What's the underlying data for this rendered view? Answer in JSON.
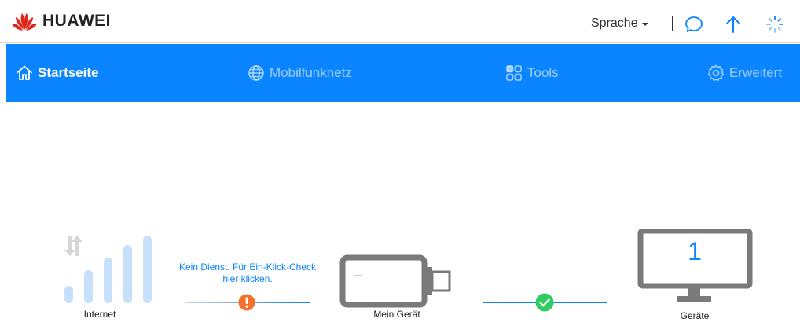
{
  "header": {
    "brand": "HUAWEI",
    "language_label": "Sprache",
    "icons": [
      "chat-icon",
      "update-arrow-icon",
      "loading-spinner-icon"
    ]
  },
  "nav": {
    "items": [
      {
        "label": "Startseite",
        "icon": "home-icon",
        "active": true
      },
      {
        "label": "Mobilfunknetz",
        "icon": "globe-icon",
        "active": false
      },
      {
        "label": "Tools",
        "icon": "grid-icon",
        "active": false
      },
      {
        "label": "Erweitert",
        "icon": "gear-icon",
        "active": false
      }
    ]
  },
  "status": {
    "internet_label": "Internet",
    "warning_text": "Kein Dienst. Für Ein-Klick-Check hier klicken.",
    "device_label": "Mein Gerät",
    "device_screen": "–",
    "devices_label": "Geräte",
    "devices_count": "1"
  },
  "colors": {
    "accent": "#0a84ff",
    "warning": "#f5702a",
    "ok": "#2fcc5f",
    "signal": "#c6dffb",
    "device_gray": "#7a7a7a"
  }
}
